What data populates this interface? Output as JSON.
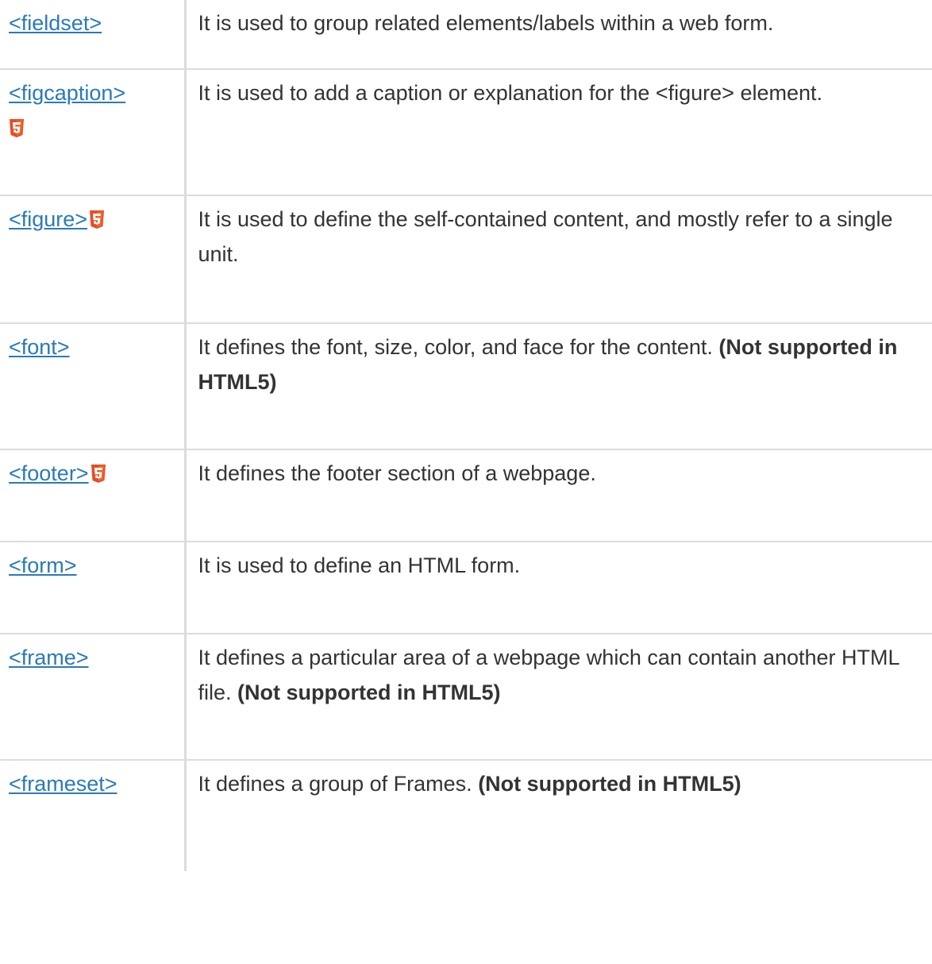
{
  "rows": [
    {
      "tag": "<fieldset>",
      "html5": false,
      "desc": "It is used to group related elements/labels within a web form.",
      "note": ""
    },
    {
      "tag": "<figcaption>",
      "html5": true,
      "html5_newline": true,
      "desc": "It is used to add a caption or explanation for the <figure> element.",
      "note": ""
    },
    {
      "tag": "<figure>",
      "html5": true,
      "desc": "It is used to define the self-contained content, and mostly refer to a single unit.",
      "note": ""
    },
    {
      "tag": "<font>",
      "html5": false,
      "desc": "It defines the font, size, color, and face for the content. ",
      "note": "(Not supported in HTML5)"
    },
    {
      "tag": "<footer>",
      "html5": true,
      "desc": "It defines the footer section of a webpage.",
      "note": ""
    },
    {
      "tag": "<form>",
      "html5": false,
      "desc": "It is used to define an HTML form.",
      "note": ""
    },
    {
      "tag": "<frame>",
      "html5": false,
      "desc": "It defines a particular area of a webpage which can contain another HTML file. ",
      "note": "(Not supported in HTML5)"
    },
    {
      "tag": "<frameset>",
      "html5": false,
      "desc": "It defines a group of Frames. ",
      "note": "(Not supported in HTML5)"
    }
  ],
  "colors": {
    "link": "#2a7ab8",
    "text": "#333333",
    "border": "#dcdcdc",
    "html5_badge": "#e44d26"
  }
}
